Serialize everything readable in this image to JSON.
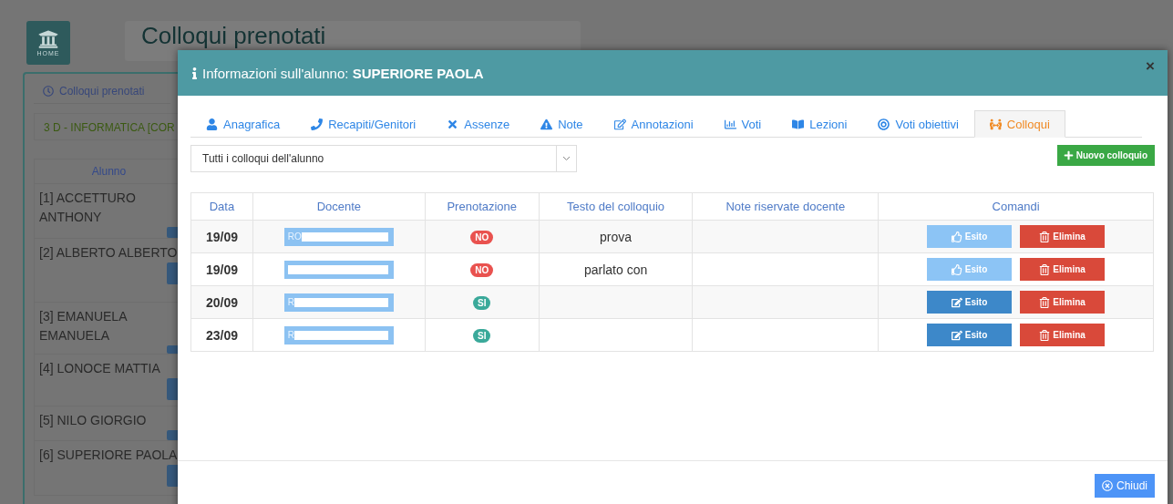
{
  "background_page": {
    "home_label": "HOME",
    "title": "Colloqui prenotati",
    "tab": "Colloqui prenotati",
    "class_label": "3 D - INFORMATICA [COR",
    "list_header": "Alunno",
    "students": [
      "[1] ACCETTURO ANTHONY",
      "[2] ALBERTO ALBERTO",
      "[3] EMANUELA EMANUELA",
      "[4] LONOCE MATTIA",
      "[5] NILO GIORGIO",
      "[6] SUPERIORE PAOLA"
    ]
  },
  "modal": {
    "title": "Informazioni sull'alunno: **SUPERIORE PAOLA**",
    "close": "×",
    "tabs": [
      {
        "label": "Anagrafica",
        "selected": false
      },
      {
        "label": "Recapiti/Genitori",
        "selected": false
      },
      {
        "label": "Assenze",
        "selected": false
      },
      {
        "label": "Note",
        "selected": false
      },
      {
        "label": "Annotazioni",
        "selected": false
      },
      {
        "label": "Voti",
        "selected": false
      },
      {
        "label": "Lezioni",
        "selected": false
      },
      {
        "label": "Voti obiettivi",
        "selected": false
      },
      {
        "label": "Colloqui",
        "selected": true
      }
    ],
    "filter": {
      "value": "Tutti i colloqui dell'alunno"
    },
    "new_button": "Nuovo colloquio",
    "table": {
      "columns": [
        "Data",
        "Docente",
        "Prenotazione",
        "Testo del colloquio",
        "Note riservate docente",
        "Comandi"
      ],
      "rows": [
        {
          "data": "19/09",
          "docente_visible": "RO",
          "prenotazione": {
            "label": "NO",
            "color": "#e9524f"
          },
          "testo": "prova",
          "esito": {
            "label": "Esito",
            "kind": "done"
          },
          "elimina": "Elimina"
        },
        {
          "data": "19/09",
          "docente_visible": "",
          "prenotazione": {
            "label": "NO",
            "color": "#e9524f"
          },
          "testo": "parlato con",
          "esito": {
            "label": "Esito",
            "kind": "done"
          },
          "elimina": "Elimina"
        },
        {
          "data": "20/09",
          "docente_visible": "R",
          "prenotazione": {
            "label": "SI",
            "color": "#3aa99a"
          },
          "testo": "",
          "esito": {
            "label": "Esito",
            "kind": "edit"
          },
          "elimina": "Elimina"
        },
        {
          "data": "23/09",
          "docente_visible": "R",
          "prenotazione": {
            "label": "SI",
            "color": "#3aa99a"
          },
          "testo": "",
          "esito": {
            "label": "Esito",
            "kind": "edit"
          },
          "elimina": "Elimina"
        }
      ]
    },
    "footer_button": "Chiudi"
  }
}
